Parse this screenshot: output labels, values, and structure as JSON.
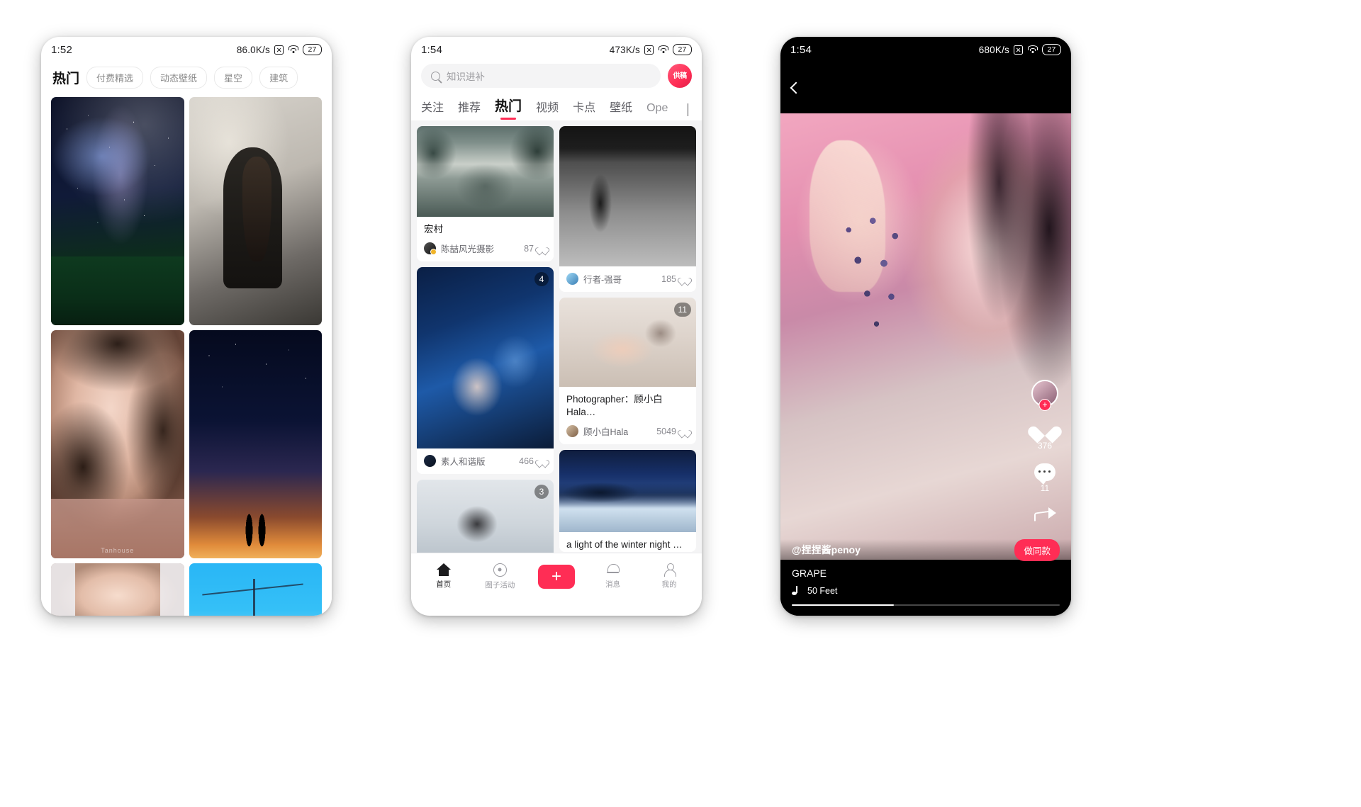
{
  "phone1": {
    "status": {
      "time": "1:52",
      "speed": "86.0K/s",
      "battery": "27",
      "icons": [
        "no-sim-icon",
        "wifi-icon",
        "battery-icon"
      ]
    },
    "active_tab": "热门",
    "chips": [
      "付费精选",
      "动态壁纸",
      "星空",
      "建筑"
    ],
    "tiles": [
      {
        "name": "milky-way-field",
        "watermark": ""
      },
      {
        "name": "girl-in-room",
        "watermark": ""
      },
      {
        "name": "portrait-girl",
        "watermark": "Tanhouse"
      },
      {
        "name": "starry-couple",
        "watermark": ""
      },
      {
        "name": "girl-street",
        "watermark": ""
      },
      {
        "name": "blue-sky-wires",
        "watermark": ""
      }
    ]
  },
  "phone2": {
    "status": {
      "time": "1:54",
      "speed": "473K/s",
      "battery": "27"
    },
    "search": {
      "placeholder": "知识进补",
      "icon": "search-icon"
    },
    "submit_badge": "供稿",
    "tabs": [
      {
        "label": "关注",
        "active": false
      },
      {
        "label": "推荐",
        "active": false
      },
      {
        "label": "热门",
        "active": true
      },
      {
        "label": "视频",
        "active": false
      },
      {
        "label": "卡点",
        "active": false
      },
      {
        "label": "壁纸",
        "active": false
      },
      {
        "label": "Ope",
        "active": false
      }
    ],
    "left_cards": [
      {
        "image": "misty-lake-trees",
        "title": "宏村",
        "author": "陈喆风光摄影",
        "likes": "87",
        "badge": ""
      },
      {
        "image": "girl-in-car-blue",
        "title": "",
        "author": "素人和谐版",
        "likes": "466",
        "badge": "4"
      },
      {
        "image": "bird-on-wire",
        "title": "",
        "author": "",
        "likes": "",
        "badge": "3"
      }
    ],
    "right_cards": [
      {
        "image": "garage-bw",
        "title": "",
        "author": "行者-强哥",
        "likes": "185",
        "badge": ""
      },
      {
        "image": "girl-on-bed",
        "title": "Photographer：顾小白Hala…",
        "author": "顾小白Hala",
        "likes": "5049",
        "badge": "11"
      },
      {
        "image": "winter-night-lake",
        "title": "a light of the winter night …",
        "author": "",
        "likes": "",
        "badge": ""
      }
    ],
    "nav": [
      {
        "label": "首页",
        "icon": "home-icon",
        "active": true
      },
      {
        "label": "圈子活动",
        "icon": "circle-activity-icon",
        "active": false
      },
      {
        "label": "",
        "icon": "plus-icon",
        "active": false
      },
      {
        "label": "消息",
        "icon": "bell-icon",
        "active": false
      },
      {
        "label": "我的",
        "icon": "user-icon",
        "active": false
      }
    ]
  },
  "phone3": {
    "status": {
      "time": "1:54",
      "speed": "680K/s",
      "battery": "27"
    },
    "back_icon": "back-chevron-icon",
    "username": "@捏捏酱penoy",
    "cta_label": "做同款",
    "title": "GRAPE",
    "music": "50 Feet",
    "music_icon": "music-note-icon",
    "rail": {
      "follow_label": "+",
      "like_count": "376",
      "comment_count": "11",
      "like_icon": "heart-icon",
      "comment_icon": "comment-icon",
      "share_icon": "share-icon",
      "avatar": "creator-avatar"
    }
  },
  "colors": {
    "accent": "#ff2d55",
    "bg": "#ffffff",
    "feed_bg": "#f4f4f5"
  }
}
